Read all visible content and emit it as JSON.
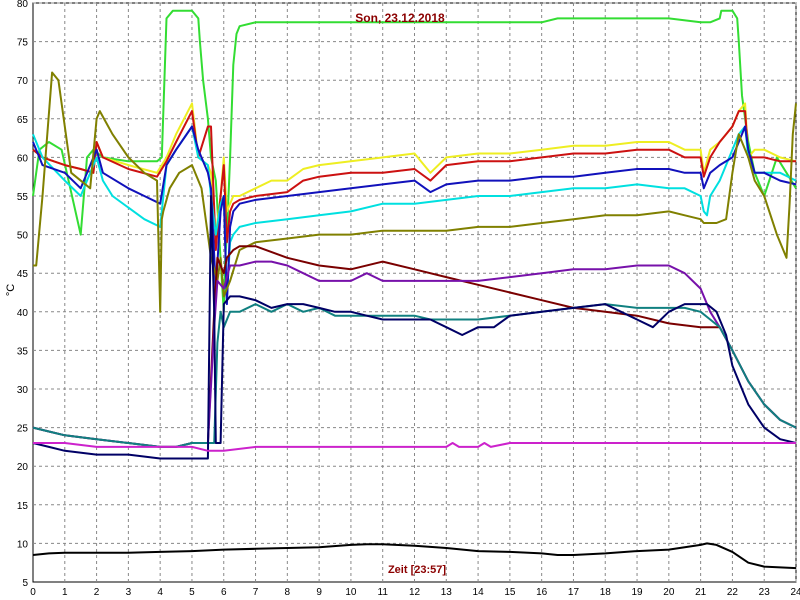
{
  "chart_data": {
    "type": "line",
    "title": "Son, 23.12.2018",
    "xlabel": "Zeit [23:57]",
    "ylabel": "°C",
    "xlim": [
      0,
      24
    ],
    "ylim": [
      5,
      80
    ],
    "xticks": [
      0,
      1,
      2,
      3,
      4,
      5,
      6,
      7,
      8,
      9,
      10,
      11,
      12,
      13,
      14,
      15,
      16,
      17,
      18,
      19,
      20,
      21,
      22,
      23,
      24
    ],
    "yticks": [
      5,
      10,
      15,
      20,
      25,
      30,
      35,
      40,
      45,
      50,
      55,
      60,
      65,
      70,
      75,
      80
    ],
    "grid": true,
    "series": [
      {
        "color": "#33dd33",
        "x": [
          0,
          0.2,
          0.5,
          0.9,
          1.5,
          1.7,
          1.9,
          2.2,
          3.0,
          3.9,
          4.05,
          4.2,
          4.4,
          4.6,
          5.0,
          5.2,
          5.25,
          5.35,
          5.5,
          5.6,
          5.75,
          6.0,
          6.05,
          6.1,
          6.2,
          6.3,
          6.4,
          6.5,
          7.0,
          8.0,
          10.0,
          12.0,
          15.0,
          16.0,
          16.5,
          17.0,
          18.0,
          19.0,
          20.0,
          21.0,
          21.3,
          21.6,
          21.65,
          21.8,
          22.0,
          22.15,
          22.2,
          22.3,
          22.5,
          22.7,
          23.0,
          23.4,
          23.7,
          24.0
        ],
        "y": [
          55,
          61,
          62,
          61,
          50,
          60,
          61,
          60,
          59.5,
          59.5,
          60,
          78,
          79,
          79,
          79,
          78,
          75,
          70,
          65,
          60,
          57,
          40,
          47,
          50,
          60,
          72,
          76,
          77,
          77.5,
          77.5,
          77.5,
          77.5,
          77.5,
          77.5,
          78,
          78,
          78,
          78,
          78,
          77.5,
          77.5,
          78,
          79,
          79,
          79,
          78,
          75,
          68,
          62,
          58,
          55,
          60,
          58,
          56
        ]
      },
      {
        "color": "#eeee22",
        "x": [
          0,
          0.3,
          1.0,
          1.5,
          1.9,
          2.0,
          2.2,
          3.0,
          3.9,
          4.2,
          4.5,
          5.0,
          5.2,
          5.5,
          5.6,
          5.75,
          5.9,
          6.0,
          6.1,
          6.2,
          6.3,
          6.5,
          7.0,
          7.5,
          8.0,
          8.5,
          9.0,
          10.0,
          11.0,
          12.0,
          12.5,
          13.0,
          14.0,
          15.0,
          16.0,
          17.0,
          18.0,
          19.0,
          20.0,
          20.5,
          21.0,
          21.1,
          21.3,
          21.6,
          21.8,
          22.0,
          22.2,
          22.4,
          22.5,
          22.7,
          23.0,
          23.5,
          24.0
        ],
        "y": [
          61,
          60,
          59,
          58.5,
          58,
          62,
          60,
          59,
          58,
          60,
          63,
          67,
          60,
          59,
          58,
          50,
          55,
          60,
          53,
          54,
          55,
          55,
          56,
          57,
          57,
          58.5,
          59,
          59.5,
          60,
          60.5,
          58,
          60,
          60.5,
          60.5,
          61,
          61.5,
          61.5,
          62,
          62,
          61,
          61,
          58,
          61,
          62,
          63,
          64,
          66,
          67,
          60,
          61,
          61,
          60,
          59.5
        ]
      },
      {
        "color": "#cc1111",
        "x": [
          0,
          0.3,
          1.0,
          1.5,
          1.9,
          2.0,
          2.2,
          3.0,
          3.9,
          4.2,
          4.5,
          5.0,
          5.2,
          5.5,
          5.6,
          5.75,
          5.9,
          6.0,
          6.1,
          6.2,
          6.3,
          6.5,
          7.0,
          8.0,
          8.5,
          9.0,
          10.0,
          11.0,
          12.0,
          12.5,
          13.0,
          14.0,
          15.0,
          16.0,
          17.0,
          18.0,
          19.0,
          20.0,
          20.5,
          21.0,
          21.1,
          21.3,
          21.6,
          21.8,
          22.0,
          22.2,
          22.4,
          22.5,
          22.7,
          23.0,
          23.5,
          24.0
        ],
        "y": [
          61,
          60,
          59,
          58.5,
          58,
          62,
          60,
          58.5,
          57.5,
          59.5,
          62,
          66,
          60,
          64,
          64,
          48,
          55,
          59,
          49,
          53,
          54,
          54.5,
          55,
          55.5,
          57,
          57.5,
          58,
          58,
          58.5,
          57,
          59,
          59.5,
          59.5,
          60,
          60.5,
          60.5,
          61,
          61,
          60,
          60,
          57.5,
          60,
          62,
          63,
          64,
          66,
          66,
          60,
          60,
          60,
          59.5,
          59.5
        ]
      },
      {
        "color": "#00e0e0",
        "x": [
          0,
          0.1,
          0.3,
          1.0,
          1.5,
          2.0,
          2.2,
          2.5,
          3.0,
          3.5,
          4.0,
          4.2,
          4.5,
          5.0,
          5.2,
          5.5,
          5.6,
          5.75,
          5.9,
          6.0,
          6.1,
          6.2,
          6.3,
          6.5,
          7.0,
          8.0,
          9.0,
          10.0,
          11.0,
          12.0,
          13.0,
          14.0,
          15.0,
          16.0,
          17.0,
          18.0,
          19.0,
          20.0,
          20.5,
          21.0,
          21.1,
          21.2,
          21.3,
          21.6,
          22.0,
          22.2,
          22.4,
          22.5,
          22.7,
          23.0,
          23.5,
          24.0
        ],
        "y": [
          63,
          62,
          60,
          57,
          55,
          60,
          57,
          55,
          53.5,
          52,
          51,
          59,
          61,
          64,
          60,
          59,
          55,
          50,
          54,
          55,
          42,
          49,
          50,
          51,
          51.5,
          52,
          52.5,
          53,
          54,
          54,
          54.5,
          55,
          55,
          55.5,
          56,
          56,
          56.5,
          56,
          56,
          55,
          53,
          52.5,
          55,
          57,
          61,
          63,
          64,
          60,
          58,
          58,
          58,
          57
        ]
      },
      {
        "color": "#1111bb",
        "x": [
          0,
          0.3,
          1.0,
          1.5,
          2.0,
          2.2,
          3.0,
          3.5,
          4.0,
          4.2,
          4.5,
          5.0,
          5.2,
          5.5,
          5.6,
          5.75,
          5.9,
          6.0,
          6.1,
          6.2,
          6.3,
          6.5,
          7.0,
          8.0,
          9.0,
          10.0,
          11.0,
          12.0,
          12.5,
          13.0,
          14.0,
          15.0,
          16.0,
          17.0,
          18.0,
          19.0,
          20.0,
          20.5,
          21.0,
          21.1,
          21.3,
          21.6,
          22.0,
          22.2,
          22.4,
          22.5,
          22.7,
          23.0,
          23.5,
          24.0
        ],
        "y": [
          62,
          59,
          58,
          56,
          61,
          58,
          56,
          55,
          54,
          59,
          61,
          64,
          61,
          58,
          56,
          43,
          53,
          55,
          41,
          51,
          53,
          54,
          54.5,
          55,
          55.5,
          56,
          56.5,
          57,
          55.5,
          56.5,
          57,
          57,
          57.5,
          57.5,
          58,
          58.5,
          58.5,
          58,
          58,
          56,
          58,
          59,
          60,
          62,
          64,
          61,
          58,
          58,
          57,
          56.5
        ]
      },
      {
        "color": "#808000",
        "x": [
          0,
          0.1,
          0.3,
          0.6,
          0.8,
          1.2,
          1.8,
          2.0,
          2.1,
          2.5,
          3.0,
          3.5,
          3.9,
          4.0,
          4.05,
          4.1,
          4.3,
          4.6,
          5.0,
          5.3,
          5.6,
          5.8,
          5.9,
          6.0,
          6.2,
          6.5,
          7.0,
          8.0,
          9.0,
          10.0,
          11.0,
          12.0,
          13.0,
          14.0,
          15.0,
          16.0,
          17.0,
          18.0,
          19.0,
          20.0,
          20.5,
          21.0,
          21.1,
          21.5,
          21.8,
          22.0,
          22.2,
          22.5,
          22.7,
          23.0,
          23.4,
          23.7,
          23.8,
          23.9,
          24.0
        ],
        "y": [
          46,
          46,
          55,
          71,
          70,
          58,
          56,
          65,
          66,
          63,
          60,
          58,
          57,
          40,
          52,
          53,
          56,
          58,
          59,
          56,
          47,
          44,
          47,
          42,
          44,
          48,
          49,
          49.5,
          50,
          50,
          50.5,
          50.5,
          50.5,
          51,
          51,
          51.5,
          52,
          52.5,
          52.5,
          53,
          52.5,
          52,
          51.5,
          51.5,
          52,
          58,
          63,
          60,
          57,
          55,
          50,
          47,
          54,
          63,
          67
        ]
      },
      {
        "color": "#7a0000",
        "x": [
          0,
          0.5,
          1.0,
          2.0,
          3.0,
          4.0,
          4.5,
          5.0,
          5.5,
          5.7,
          5.8,
          6.0,
          6.1,
          6.3,
          6.5,
          7.0,
          8.0,
          9.0,
          10.0,
          11.0,
          12.0,
          13.0,
          14.0,
          15.0,
          16.0,
          17.0,
          18.0,
          19.0,
          20.0,
          21.0,
          21.3,
          21.6,
          22.0,
          22.5,
          23.0,
          23.5,
          24.0
        ],
        "y": [
          25,
          24.5,
          24,
          23.5,
          23,
          22.5,
          22.5,
          23,
          23,
          40,
          47,
          45,
          47,
          48,
          48.5,
          48.5,
          47,
          46,
          45.5,
          46.5,
          45.5,
          44.5,
          43.5,
          42.5,
          41.5,
          40.5,
          40,
          39.5,
          38.5,
          38,
          38,
          38,
          35,
          31,
          28,
          26,
          25
        ]
      },
      {
        "color": "#7711aa",
        "x": [
          0,
          0.5,
          1.0,
          2.0,
          3.0,
          4.0,
          4.5,
          5.0,
          5.5,
          5.7,
          5.8,
          6.0,
          6.2,
          6.5,
          7.0,
          7.5,
          8.0,
          8.5,
          9.0,
          10.0,
          10.5,
          11.0,
          12.0,
          13.0,
          14.0,
          15.0,
          16.0,
          17.0,
          18.0,
          19.0,
          20.0,
          20.5,
          21.0,
          21.3,
          21.6,
          22.0,
          22.5,
          23.0,
          23.5,
          24.0
        ],
        "y": [
          25,
          24.5,
          24,
          23.5,
          23,
          22.5,
          22.5,
          23,
          23,
          38,
          44,
          43,
          46,
          46,
          46.5,
          46.5,
          46,
          45,
          44,
          44,
          45,
          44,
          44,
          44,
          44,
          44.5,
          45,
          45.5,
          45.5,
          46,
          46,
          45,
          43,
          40,
          38,
          35,
          31,
          28,
          26,
          25
        ]
      },
      {
        "color": "#108080",
        "x": [
          0,
          0.5,
          1.0,
          2.0,
          3.0,
          4.0,
          4.5,
          5.0,
          5.5,
          5.7,
          5.8,
          5.9,
          6.0,
          6.2,
          6.5,
          7.0,
          7.5,
          8.0,
          8.5,
          9.0,
          9.5,
          10.0,
          11.0,
          12.0,
          12.5,
          13.0,
          14.0,
          15.0,
          16.0,
          17.0,
          18.0,
          19.0,
          20.0,
          20.5,
          21.0,
          21.3,
          21.6,
          22.0,
          22.5,
          23.0,
          23.5,
          24.0
        ],
        "y": [
          25,
          24.5,
          24,
          23.5,
          23,
          22.5,
          22.5,
          23,
          23,
          23,
          36,
          40,
          38,
          40,
          40,
          41,
          40,
          41,
          40,
          40.5,
          39.5,
          39.5,
          39.5,
          39.5,
          39,
          39,
          39,
          39.5,
          40,
          40.5,
          41,
          40.5,
          40.5,
          40.5,
          40,
          39,
          38,
          35,
          31,
          28,
          26,
          25
        ]
      },
      {
        "color": "#000066",
        "x": [
          0,
          0.5,
          1.0,
          2.0,
          3.0,
          4.0,
          4.5,
          5.0,
          5.5,
          5.6,
          5.7,
          5.75,
          5.8,
          5.9,
          6.0,
          6.2,
          6.5,
          7.0,
          7.5,
          8.0,
          8.5,
          9.0,
          9.5,
          10.0,
          10.5,
          11.0,
          12.0,
          12.5,
          13.0,
          13.5,
          14.0,
          14.5,
          15.0,
          16.0,
          17.0,
          18.0,
          18.5,
          19.0,
          19.5,
          20.0,
          20.5,
          21.0,
          21.2,
          21.5,
          21.8,
          22.0,
          22.5,
          23.0,
          23.5,
          24.0
        ],
        "y": [
          23,
          22.5,
          22,
          21.5,
          21.5,
          21,
          21,
          21,
          21,
          55,
          40,
          23,
          23,
          23,
          41,
          42,
          42,
          41.5,
          40.5,
          41,
          41,
          40.5,
          40,
          40,
          39.5,
          39,
          39,
          39,
          38,
          37,
          38,
          38,
          39.5,
          40,
          40.5,
          41,
          40,
          39,
          38,
          40,
          41,
          41,
          41,
          40,
          37,
          33,
          28,
          25,
          23.5,
          23
        ]
      },
      {
        "color": "#cc22cc",
        "x": [
          0,
          0.5,
          1.0,
          2.0,
          3.0,
          4.0,
          5.0,
          5.5,
          5.8,
          6.0,
          7.0,
          8.0,
          9.0,
          10.0,
          11.0,
          12.0,
          13.0,
          13.2,
          13.4,
          14.0,
          14.2,
          14.4,
          15.0,
          16.0,
          17.0,
          18.0,
          19.0,
          20.0,
          21.0,
          22.0,
          23.0,
          24.0
        ],
        "y": [
          23,
          23,
          23,
          22.5,
          22.5,
          22.5,
          22.5,
          22,
          22,
          22,
          22.5,
          22.5,
          22.5,
          22.5,
          22.5,
          22.5,
          22.5,
          23,
          22.5,
          22.5,
          23,
          22.5,
          23,
          23,
          23,
          23,
          23,
          23,
          23,
          23,
          23,
          23
        ]
      },
      {
        "color": "#000000",
        "x": [
          0,
          0.5,
          1.0,
          2.0,
          3.0,
          4.0,
          5.0,
          6.0,
          7.0,
          8.0,
          9.0,
          10.0,
          10.5,
          11.0,
          12.0,
          13.0,
          14.0,
          15.0,
          16.0,
          16.5,
          17.0,
          18.0,
          19.0,
          20.0,
          20.5,
          21.0,
          21.2,
          21.5,
          22.0,
          22.5,
          23.0,
          24.0
        ],
        "y": [
          8.5,
          8.7,
          8.8,
          8.8,
          8.8,
          8.9,
          9.0,
          9.2,
          9.3,
          9.4,
          9.5,
          9.8,
          9.9,
          9.9,
          9.7,
          9.4,
          9.0,
          8.9,
          8.7,
          8.5,
          8.5,
          8.7,
          9.0,
          9.2,
          9.5,
          9.8,
          10,
          9.8,
          8.9,
          7.5,
          7.0,
          6.8
        ]
      }
    ]
  }
}
